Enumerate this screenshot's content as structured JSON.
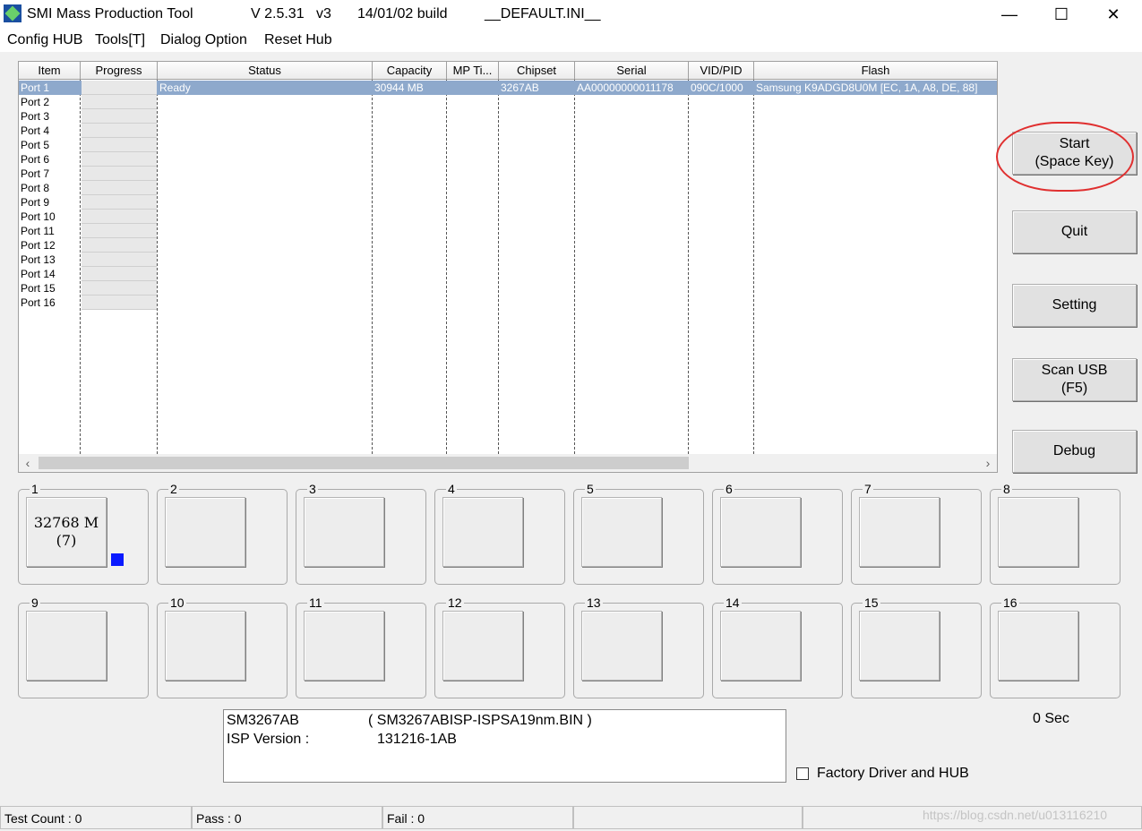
{
  "title_bar": {
    "app_name": "SMI Mass Production Tool",
    "version": "V 2.5.31   v3",
    "build": "14/01/02 build",
    "ini_file": "__DEFAULT.INI__",
    "minimize": "—",
    "maximize": "☐",
    "close": "✕"
  },
  "menu": [
    "Config HUB",
    "Tools[T]",
    "Dialog Option",
    "Reset Hub"
  ],
  "table": {
    "columns": [
      "Item",
      "Progress",
      "Status",
      "Capacity",
      "MP Ti...",
      "Chipset",
      "Serial",
      "VID/PID",
      "Flash"
    ],
    "rows": [
      {
        "item": "Port 1",
        "status": "Ready",
        "capacity": "30944 MB",
        "chipset": "3267AB",
        "serial": "AA00000000011178",
        "vidpid": "090C/1000",
        "flash": "Samsung K9ADGD8U0M [EC, 1A, A8, DE, 88]",
        "selected": true
      },
      {
        "item": "Port 2"
      },
      {
        "item": "Port 3"
      },
      {
        "item": "Port 4"
      },
      {
        "item": "Port 5"
      },
      {
        "item": "Port 6"
      },
      {
        "item": "Port 7"
      },
      {
        "item": "Port 8"
      },
      {
        "item": "Port 9"
      },
      {
        "item": "Port 10"
      },
      {
        "item": "Port 11"
      },
      {
        "item": "Port 12"
      },
      {
        "item": "Port 13"
      },
      {
        "item": "Port 14"
      },
      {
        "item": "Port 15"
      },
      {
        "item": "Port 16"
      }
    ]
  },
  "buttons": {
    "start": "Start\n(Space Key)",
    "quit": "Quit",
    "setting": "Setting",
    "scan_usb": "Scan USB\n(F5)",
    "debug": "Debug"
  },
  "ports": [
    {
      "num": "1",
      "line1": "32768 M",
      "line2": "(7)",
      "indicator_color": "#0a1aff"
    },
    {
      "num": "2"
    },
    {
      "num": "3"
    },
    {
      "num": "4"
    },
    {
      "num": "5"
    },
    {
      "num": "6"
    },
    {
      "num": "7"
    },
    {
      "num": "8"
    },
    {
      "num": "9"
    },
    {
      "num": "10"
    },
    {
      "num": "11"
    },
    {
      "num": "12"
    },
    {
      "num": "13"
    },
    {
      "num": "14"
    },
    {
      "num": "15"
    },
    {
      "num": "16"
    }
  ],
  "info": {
    "chip": "SM3267AB",
    "bin_file": "( SM3267ABISP-ISPSA19nm.BIN )",
    "isp_label": "ISP Version :",
    "isp_version": "131216-1AB"
  },
  "timer": "0 Sec",
  "factory_driver": {
    "label": "Factory Driver and HUB",
    "checked": false
  },
  "status_bar": {
    "test_count": "Test Count : 0",
    "pass": "Pass : 0",
    "fail": "Fail : 0"
  },
  "watermark": "https://blog.csdn.net/u013116210"
}
